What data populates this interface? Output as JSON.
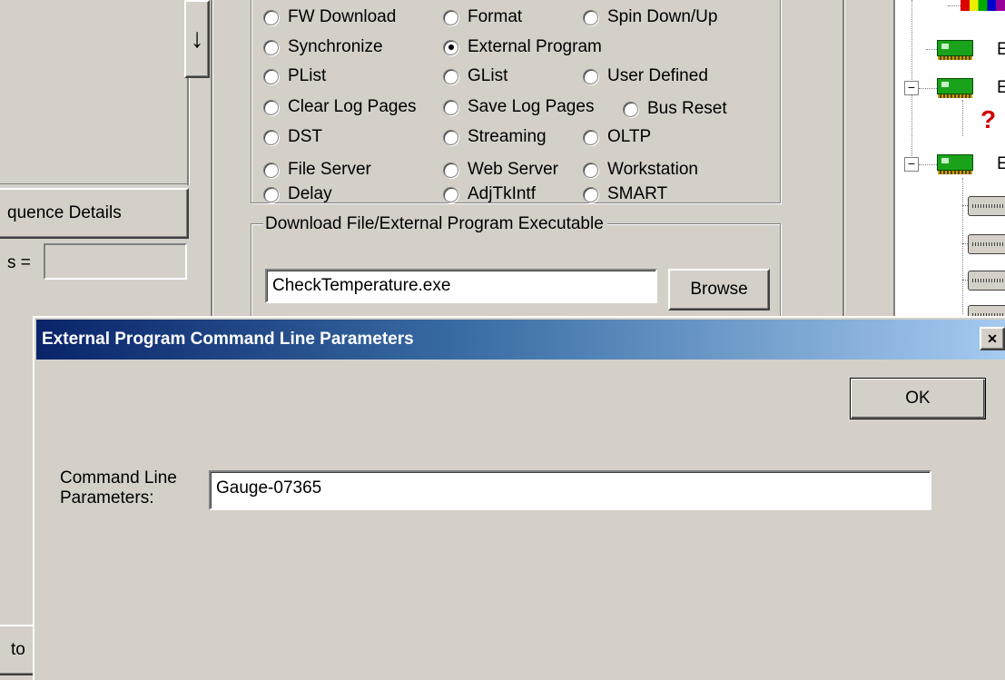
{
  "left_panel": {
    "sequence_details_button": "quence Details",
    "field_label": "s =",
    "field_value": "",
    "bottom_button": "to"
  },
  "scroll_down_arrow": "↓",
  "options": {
    "row0": [
      "FW Download",
      "Format",
      "Spin Down/Up"
    ],
    "row1": [
      "Synchronize",
      "External Program"
    ],
    "row2": [
      "PList",
      "GList",
      "User Defined"
    ],
    "row3": [
      "Clear Log Pages",
      "Save Log Pages",
      "Bus Reset"
    ],
    "row4": [
      "DST",
      "Streaming",
      "OLTP"
    ],
    "row5": [
      "File Server",
      "Web Server",
      "Workstation"
    ],
    "row6": [
      "Delay",
      "AdjTkIntf",
      "SMART"
    ],
    "selected": "External Program"
  },
  "download_group": {
    "title": "Download File/External Program Executable",
    "file_value": "CheckTemperature.exe",
    "browse_label": "Browse"
  },
  "tree": {
    "node_letter": "E"
  },
  "dialog": {
    "title": "External Program Command Line Parameters",
    "close_glyph": "✕",
    "ok_label": "OK",
    "param_label_line1": "Command Line",
    "param_label_line2": "Parameters:",
    "param_value": "Gauge-07365"
  },
  "colors": {
    "title_gradient_start": "#0a246a",
    "title_gradient_end": "#a6caf0",
    "face": "#d4d0c8"
  }
}
